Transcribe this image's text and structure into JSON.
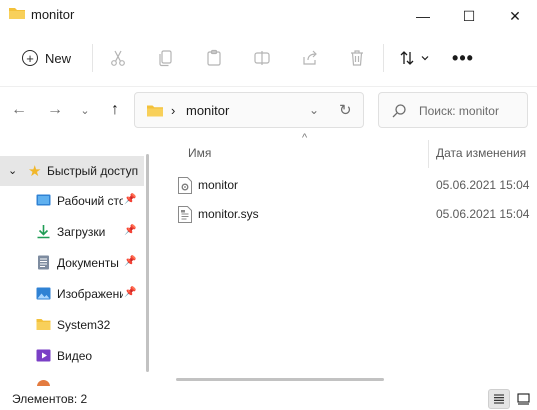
{
  "window": {
    "title": "monitor",
    "controls": {
      "minimize_glyph": "—",
      "maximize_glyph": "☐",
      "close_glyph": "✕"
    }
  },
  "toolbar": {
    "new_label": "New",
    "icons": [
      "cut-icon",
      "copy-icon",
      "paste-icon",
      "rename-icon",
      "share-icon",
      "delete-icon",
      "sort-icon",
      "more-icon"
    ],
    "more_glyph": "•••"
  },
  "nav": {
    "back_glyph": "←",
    "forward_glyph": "→",
    "recent_glyph": "⌄",
    "up_glyph": "↑"
  },
  "address": {
    "chevron": "›",
    "path": "monitor",
    "dropdown_glyph": "⌄",
    "refresh_glyph": "↻"
  },
  "search": {
    "placeholder": "Поиск: monitor"
  },
  "sidebar": {
    "quick_access": {
      "label": "Быстрый доступ",
      "expanded": true
    },
    "items": [
      {
        "label": "Рабочий стол",
        "icon": "desktop-icon",
        "pinned": true
      },
      {
        "label": "Загрузки",
        "icon": "downloads-icon",
        "pinned": true
      },
      {
        "label": "Документы",
        "icon": "documents-icon",
        "pinned": true
      },
      {
        "label": "Изображения",
        "icon": "pictures-icon",
        "pinned": true
      },
      {
        "label": "System32",
        "icon": "folder-icon",
        "pinned": false
      },
      {
        "label": "Видео",
        "icon": "videos-icon",
        "pinned": false
      }
    ],
    "pin_glyph": "📌"
  },
  "content": {
    "sort_caret": "^",
    "columns": {
      "name": "Имя",
      "date_modified": "Дата изменения"
    },
    "files": [
      {
        "name": "monitor",
        "date": "05.06.2021 15:04",
        "icon": "settings-file-icon"
      },
      {
        "name": "monitor.sys",
        "date": "05.06.2021 15:04",
        "icon": "system-file-icon"
      }
    ]
  },
  "status": {
    "text": "Элементов: 2"
  },
  "colors": {
    "accent": "#0067c0",
    "folder": "#f3c13a",
    "selection": "#e6e6e6"
  }
}
